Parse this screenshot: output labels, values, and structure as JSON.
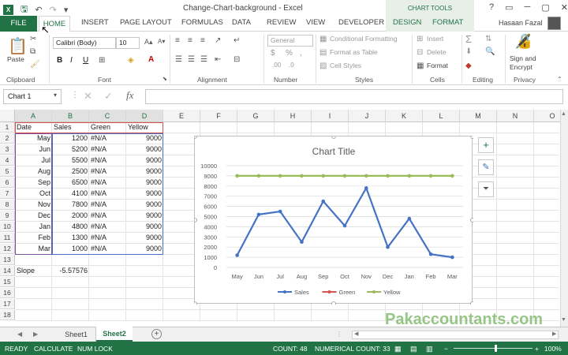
{
  "window": {
    "title": "Change-Chart-background - Excel",
    "context_group": "CHART TOOLS",
    "user": "Hasaan Fazal",
    "controls": [
      "?",
      "▭",
      "─",
      "▢",
      "✕"
    ]
  },
  "qat": [
    "save",
    "undo",
    "redo",
    "customize"
  ],
  "tabs": {
    "file": "FILE",
    "home": "HOME",
    "items": [
      "INSERT",
      "PAGE LAYOUT",
      "FORMULAS",
      "DATA",
      "REVIEW",
      "VIEW",
      "DEVELOPER",
      "DESIGN",
      "FORMAT"
    ]
  },
  "ribbon": {
    "clipboard": {
      "label": "Clipboard",
      "paste": "Paste"
    },
    "font": {
      "label": "Font",
      "name": "Calibri (Body)",
      "size": "10",
      "bold": "B",
      "italic": "I",
      "underline": "U"
    },
    "alignment": {
      "label": "Alignment"
    },
    "number": {
      "label": "Number",
      "format": "General",
      "currency": "$",
      "percent": "%"
    },
    "styles": {
      "label": "Styles",
      "conditional": "Conditional Formatting",
      "table": "Format as Table",
      "cell": "Cell Styles"
    },
    "cells": {
      "label": "Cells",
      "insert": "Insert",
      "delete": "Delete",
      "format": "Format"
    },
    "editing": {
      "label": "Editing",
      "sum": "Σ"
    },
    "privacy": {
      "label": "Privacy",
      "sign1": "Sign and",
      "sign2": "Encrypt"
    }
  },
  "formula_bar": {
    "name_box": "Chart 1",
    "fx": "fx",
    "value": ""
  },
  "columns": [
    "A",
    "B",
    "C",
    "D",
    "E",
    "F",
    "G",
    "H",
    "I",
    "J",
    "K",
    "L",
    "M",
    "N",
    "O"
  ],
  "rows": [
    "1",
    "2",
    "3",
    "4",
    "5",
    "6",
    "7",
    "8",
    "9",
    "10",
    "11",
    "12",
    "13",
    "14",
    "15",
    "16",
    "17",
    "18"
  ],
  "table": {
    "headers": [
      "Date",
      "Sales",
      "Green",
      "Yellow"
    ],
    "rows": [
      [
        "May",
        "1200",
        "#N/A",
        "9000"
      ],
      [
        "Jun",
        "5200",
        "#N/A",
        "9000"
      ],
      [
        "Jul",
        "5500",
        "#N/A",
        "9000"
      ],
      [
        "Aug",
        "2500",
        "#N/A",
        "9000"
      ],
      [
        "Sep",
        "6500",
        "#N/A",
        "9000"
      ],
      [
        "Oct",
        "4100",
        "#N/A",
        "9000"
      ],
      [
        "Nov",
        "7800",
        "#N/A",
        "9000"
      ],
      [
        "Dec",
        "2000",
        "#N/A",
        "9000"
      ],
      [
        "Jan",
        "4800",
        "#N/A",
        "9000"
      ],
      [
        "Feb",
        "1300",
        "#N/A",
        "9000"
      ],
      [
        "Mar",
        "1000",
        "#N/A",
        "9000"
      ]
    ],
    "slope_label": "Slope",
    "slope_value": "-5.57576"
  },
  "chart_data": {
    "type": "line",
    "title": "Chart Title",
    "categories": [
      "May",
      "Jun",
      "Jul",
      "Aug",
      "Sep",
      "Oct",
      "Nov",
      "Dec",
      "Jan",
      "Feb",
      "Mar"
    ],
    "series": [
      {
        "name": "Sales",
        "color": "#4472c4",
        "values": [
          1200,
          5200,
          5500,
          2500,
          6500,
          4100,
          7800,
          2000,
          4800,
          1300,
          1000
        ]
      },
      {
        "name": "Green",
        "color": "#d9534f",
        "values": []
      },
      {
        "name": "Yellow",
        "color": "#9bbb59",
        "values": [
          9000,
          9000,
          9000,
          9000,
          9000,
          9000,
          9000,
          9000,
          9000,
          9000,
          9000
        ]
      }
    ],
    "ylim": [
      0,
      10000
    ],
    "yticks": [
      "0",
      "1000",
      "2000",
      "3000",
      "4000",
      "5000",
      "6000",
      "7000",
      "8000",
      "9000",
      "10000"
    ],
    "legend": "bottom",
    "grid": true
  },
  "chart_buttons": [
    "+",
    "✎",
    "⏷"
  ],
  "sheets": [
    "Sheet1",
    "Sheet2"
  ],
  "active_sheet": "Sheet2",
  "watermark": "Pakaccountants.com",
  "status": {
    "ready": "READY",
    "calc": "CALCULATE",
    "numlock": "NUM LOCK",
    "count": "COUNT: 48",
    "numcount": "NUMERICAL COUNT: 33",
    "zoom": "100%"
  },
  "colors": {
    "accent": "#217346"
  }
}
